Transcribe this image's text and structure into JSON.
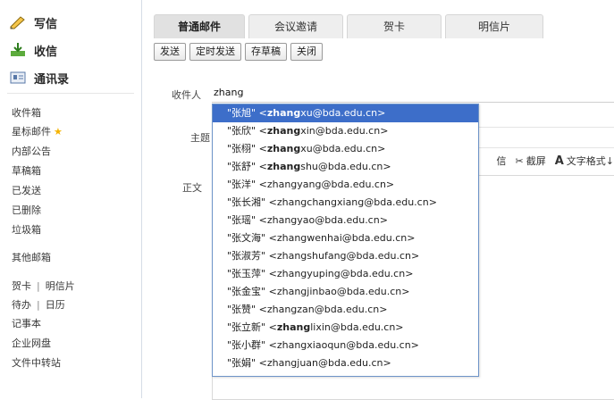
{
  "sidebar": {
    "compose": "写信",
    "receive": "收信",
    "contacts": "通讯录",
    "folders": [
      "收件箱",
      "星标邮件",
      "内部公告",
      "草稿箱",
      "已发送",
      "已删除",
      "垃圾箱"
    ],
    "other_mailbox": "其他邮箱",
    "links": {
      "greeting_card": "贺卡",
      "postcard": "明信片",
      "todo": "待办",
      "calendar": "日历",
      "notebook": "记事本",
      "enterprise_disk": "企业网盘",
      "file_transfer": "文件中转站"
    }
  },
  "tabs": [
    "普通邮件",
    "会议邀请",
    "贺卡",
    "明信片"
  ],
  "toolbar": {
    "send": "发送",
    "scheduled_send": "定时发送",
    "save_draft": "存草稿",
    "close": "关闭"
  },
  "compose": {
    "to_label": "收件人",
    "to_value": "zhang",
    "subject_label": "主题",
    "body_label": "正文"
  },
  "format_bar": {
    "item1": "信",
    "screenshot": "截屏",
    "text_format": "文字格式↓"
  },
  "suggestions": [
    {
      "name": "\"张旭\"",
      "match": "zhang",
      "rest": "xu@bda.edu.cn>"
    },
    {
      "name": "\"张欣\"",
      "match": "zhang",
      "rest": "xin@bda.edu.cn>"
    },
    {
      "name": "\"张栩\"",
      "match": "zhang",
      "rest": "xu@bda.edu.cn>"
    },
    {
      "name": "\"张舒\"",
      "match": "zhang",
      "rest": "shu@bda.edu.cn>"
    },
    {
      "name": "\"张洋\"",
      "match": "",
      "rest": "zhangyang@bda.edu.cn>"
    },
    {
      "name": "\"张长湘\"",
      "match": "",
      "rest": "zhangchangxiang@bda.edu.cn>"
    },
    {
      "name": "\"张瑶\"",
      "match": "",
      "rest": "zhangyao@bda.edu.cn>"
    },
    {
      "name": "\"张文海\"",
      "match": "",
      "rest": "zhangwenhai@bda.edu.cn>"
    },
    {
      "name": "\"张淑芳\"",
      "match": "",
      "rest": "zhangshufang@bda.edu.cn>"
    },
    {
      "name": "\"张玉萍\"",
      "match": "",
      "rest": "zhangyuping@bda.edu.cn>"
    },
    {
      "name": "\"张金宝\"",
      "match": "",
      "rest": "zhangjinbao@bda.edu.cn>"
    },
    {
      "name": "\"张赞\"",
      "match": "",
      "rest": "zhangzan@bda.edu.cn>"
    },
    {
      "name": "\"张立新\"",
      "match": "zhang",
      "rest": "lixin@bda.edu.cn>"
    },
    {
      "name": "\"张小群\"",
      "match": "",
      "rest": "zhangxiaoqun@bda.edu.cn>"
    },
    {
      "name": "\"张娟\"",
      "match": "",
      "rest": "zhangjuan@bda.edu.cn>"
    }
  ],
  "colors": {
    "selection": "#3d6ec9",
    "star": "#f5b301"
  }
}
